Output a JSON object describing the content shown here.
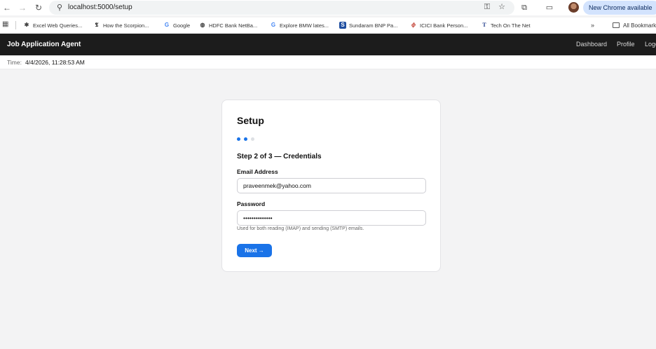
{
  "browser": {
    "url": "localhost:5000/setup",
    "update_button": "New Chrome available",
    "bookmarks": [
      {
        "label": "Excel Web Queries...",
        "icon": "sparkle-icon"
      },
      {
        "label": "How the Scorpion...",
        "icon": "nyt-icon"
      },
      {
        "label": "Google",
        "icon": "google-icon"
      },
      {
        "label": "HDFC Bank NetBa...",
        "icon": "globe-icon"
      },
      {
        "label": "Explore BMW lates...",
        "icon": "google-icon"
      },
      {
        "label": "Sundaram BNP Pa...",
        "icon": "sundaram-icon"
      },
      {
        "label": "ICICI Bank Person...",
        "icon": "icici-icon"
      },
      {
        "label": "Tech On The Net",
        "icon": "t-icon"
      }
    ],
    "more_bookmarks": "»",
    "all_bookmarks": "All Bookmarks"
  },
  "app": {
    "title": "Job Application Agent",
    "nav": [
      "Dashboard",
      "Profile",
      "Logout"
    ]
  },
  "time": {
    "label": "Time:",
    "value": "4/4/2026, 11:28:53 AM"
  },
  "setup": {
    "title": "Setup",
    "steps_total": 3,
    "current_step": 2,
    "step_title": "Step 2 of 3 — Credentials",
    "email_label": "Email Address",
    "email_value": "praveenmek@yahoo.com",
    "password_label": "Password",
    "password_value": "••••••••••••••",
    "hint": "Used for both reading (IMAP) and sending (SMTP) emails.",
    "next_label": "Next →"
  },
  "colors": {
    "accent": "#1a73e8",
    "header_bg": "#1c1c1c",
    "page_bg": "#f3f3f4",
    "dot_inactive": "#dde0e4"
  }
}
